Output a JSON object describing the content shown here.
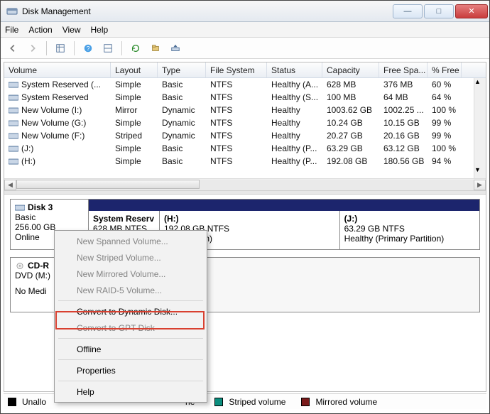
{
  "window": {
    "title": "Disk Management",
    "min": "—",
    "max": "□",
    "close": "✕"
  },
  "menu": {
    "file": "File",
    "action": "Action",
    "view": "View",
    "help": "Help"
  },
  "columns": {
    "volume": "Volume",
    "layout": "Layout",
    "type": "Type",
    "fs": "File System",
    "status": "Status",
    "capacity": "Capacity",
    "free": "Free Spa...",
    "pct": "% Free"
  },
  "volumes": [
    {
      "name": "(H:)",
      "layout": "Simple",
      "type": "Basic",
      "fs": "NTFS",
      "status": "Healthy (P...",
      "capacity": "192.08 GB",
      "free": "180.56 GB",
      "pct": "94 %"
    },
    {
      "name": "(J:)",
      "layout": "Simple",
      "type": "Basic",
      "fs": "NTFS",
      "status": "Healthy (P...",
      "capacity": "63.29 GB",
      "free": "63.12 GB",
      "pct": "100 %"
    },
    {
      "name": "New Volume (F:)",
      "layout": "Striped",
      "type": "Dynamic",
      "fs": "NTFS",
      "status": "Healthy",
      "capacity": "20.27 GB",
      "free": "20.16 GB",
      "pct": "99 %"
    },
    {
      "name": "New Volume (G:)",
      "layout": "Simple",
      "type": "Dynamic",
      "fs": "NTFS",
      "status": "Healthy",
      "capacity": "10.24 GB",
      "free": "10.15 GB",
      "pct": "99 %"
    },
    {
      "name": "New Volume (I:)",
      "layout": "Mirror",
      "type": "Dynamic",
      "fs": "NTFS",
      "status": "Healthy",
      "capacity": "1003.62 GB",
      "free": "1002.25 ...",
      "pct": "100 %"
    },
    {
      "name": "System Reserved",
      "layout": "Simple",
      "type": "Basic",
      "fs": "NTFS",
      "status": "Healthy (S...",
      "capacity": "100 MB",
      "free": "64 MB",
      "pct": "64 %"
    },
    {
      "name": "System Reserved (...",
      "layout": "Simple",
      "type": "Basic",
      "fs": "NTFS",
      "status": "Healthy (A...",
      "capacity": "628 MB",
      "free": "376 MB",
      "pct": "60 %"
    }
  ],
  "disk3": {
    "title": "Disk 3",
    "type": "Basic",
    "size": "256.00 GB",
    "state": "Online",
    "parts": [
      {
        "name": "System Reserv",
        "sub": "628 MB NTFS",
        "status": ""
      },
      {
        "name": "(H:)",
        "sub": "192.08 GB NTFS",
        "status": "ary Partition)"
      },
      {
        "name": "(J:)",
        "sub": "63.29 GB NTFS",
        "status": "Healthy (Primary Partition)"
      }
    ]
  },
  "cdrom": {
    "title": "CD-R",
    "type": "DVD (M:)",
    "state": "No Medi"
  },
  "legend": {
    "unallocated": "Unallo",
    "primary": "ne",
    "striped": "Striped volume",
    "mirrored": "Mirrored volume"
  },
  "context_menu": {
    "spanned": "New Spanned Volume...",
    "striped": "New Striped Volume...",
    "mirrored": "New Mirrored Volume...",
    "raid5": "New RAID-5 Volume...",
    "convert_dynamic": "Convert to Dynamic Disk...",
    "convert_gpt": "Convert to GPT Disk",
    "offline": "Offline",
    "properties": "Properties",
    "help": "Help"
  }
}
